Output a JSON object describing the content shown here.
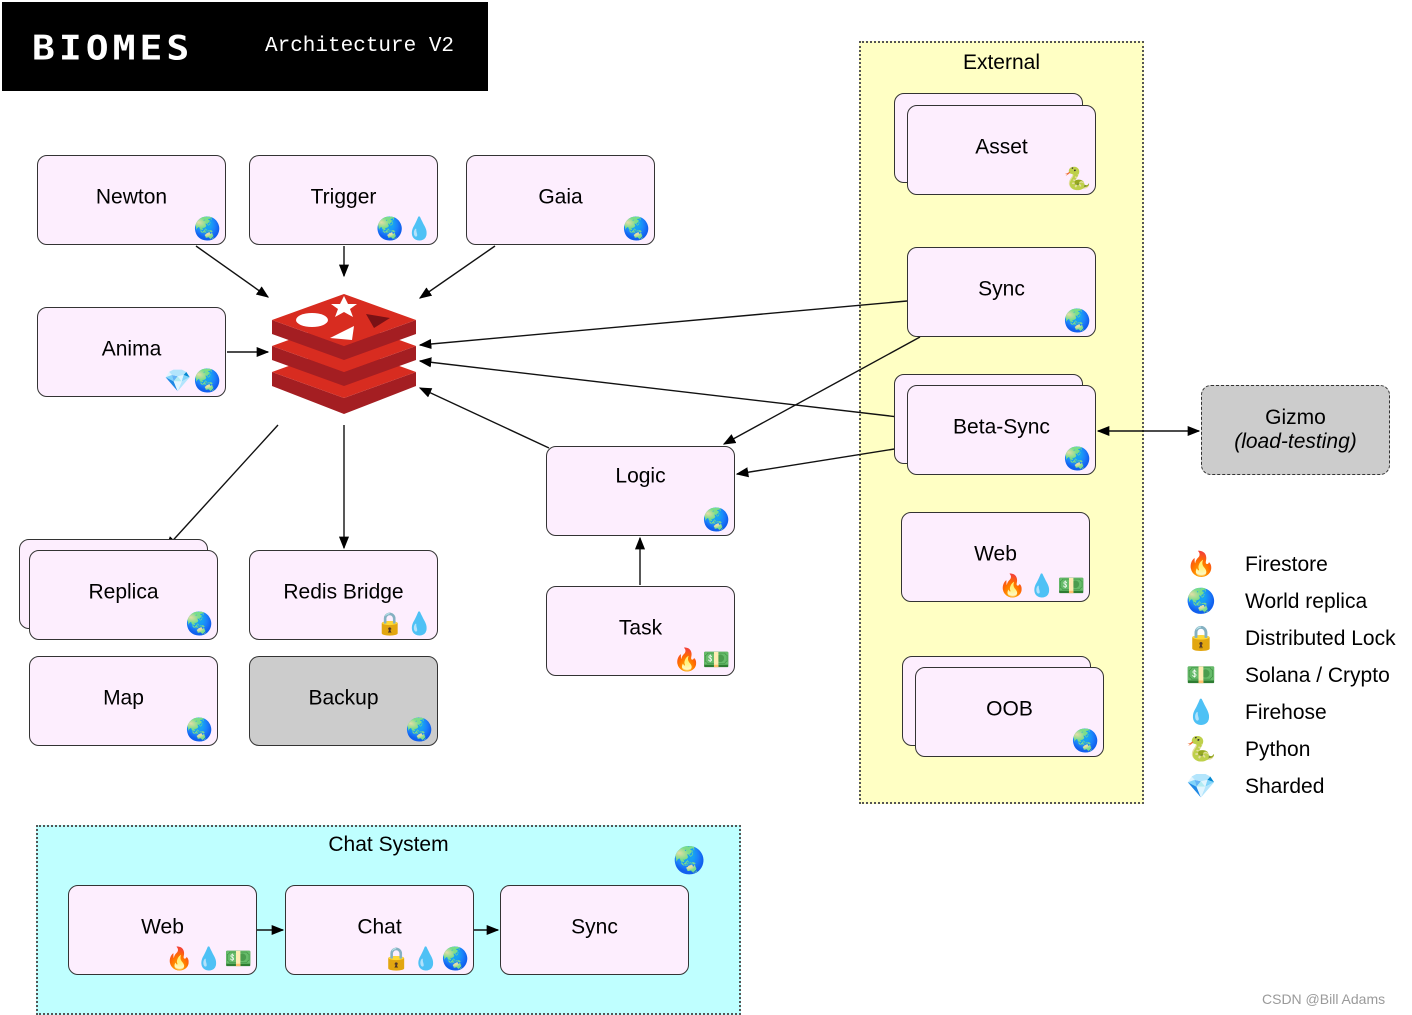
{
  "header": {
    "logo": "BIOMES",
    "subtitle": "Architecture V2"
  },
  "icons": {
    "firestore": "🔥",
    "world_replica": "🌏",
    "distributed_lock": "🔒",
    "solana": "💵",
    "firehose": "💧",
    "python": "🐍",
    "sharded": "💎"
  },
  "hub": {
    "name": "Redis",
    "icon": "redis-logo-icon"
  },
  "nodes": {
    "newton": {
      "label": "Newton",
      "badges": [
        "🌏"
      ]
    },
    "trigger": {
      "label": "Trigger",
      "badges": [
        "🌏",
        "💧"
      ]
    },
    "gaia": {
      "label": "Gaia",
      "badges": [
        "🌏"
      ]
    },
    "anima": {
      "label": "Anima",
      "badges": [
        "💎",
        "🌏"
      ]
    },
    "replica": {
      "label": "Replica",
      "badges": [
        "🌏"
      ]
    },
    "redis_bridge": {
      "label": "Redis Bridge",
      "badges": [
        "🔒",
        "💧"
      ]
    },
    "map": {
      "label": "Map",
      "badges": [
        "🌏"
      ]
    },
    "backup": {
      "label": "Backup",
      "badges": [
        "🌏"
      ]
    },
    "logic": {
      "label": "Logic",
      "badges": [
        "🌏"
      ]
    },
    "task": {
      "label": "Task",
      "badges": [
        "🔥",
        "💵"
      ]
    },
    "gizmo": {
      "label": "Gizmo",
      "sublabel": "(load-testing)"
    }
  },
  "external": {
    "title": "External",
    "nodes": {
      "asset": {
        "label": "Asset",
        "badges": [
          "🐍"
        ]
      },
      "sync": {
        "label": "Sync",
        "badges": [
          "🌏"
        ]
      },
      "beta_sync": {
        "label": "Beta-Sync",
        "badges": [
          "🌏"
        ]
      },
      "web": {
        "label": "Web",
        "badges": [
          "🔥",
          "💧",
          "💵"
        ]
      },
      "oob": {
        "label": "OOB",
        "badges": [
          "🌏"
        ]
      }
    }
  },
  "chat_system": {
    "title": "Chat System",
    "badge": "🌏",
    "nodes": {
      "web": {
        "label": "Web",
        "badges": [
          "🔥",
          "💧",
          "💵"
        ]
      },
      "chat": {
        "label": "Chat",
        "badges": [
          "🔒",
          "💧",
          "🌏"
        ]
      },
      "sync": {
        "label": "Sync",
        "badges": []
      }
    }
  },
  "legend": [
    {
      "icon": "🔥",
      "name": "fire-icon",
      "label": "Firestore"
    },
    {
      "icon": "🌏",
      "name": "globe-icon",
      "label": "World replica"
    },
    {
      "icon": "🔒",
      "name": "lock-icon",
      "label": "Distributed Lock"
    },
    {
      "icon": "💵",
      "name": "money-icon",
      "label": "Solana / Crypto"
    },
    {
      "icon": "💧",
      "name": "droplet-icon",
      "label": "Firehose"
    },
    {
      "icon": "🐍",
      "name": "snake-icon",
      "label": "Python"
    },
    {
      "icon": "💎",
      "name": "gem-icon",
      "label": "Sharded"
    }
  ],
  "edges": [
    {
      "from": "Newton",
      "to": "Redis"
    },
    {
      "from": "Trigger",
      "to": "Redis"
    },
    {
      "from": "Gaia",
      "to": "Redis"
    },
    {
      "from": "Anima",
      "to": "Redis"
    },
    {
      "from": "Sync",
      "to": "Redis"
    },
    {
      "from": "Beta-Sync",
      "to": "Redis"
    },
    {
      "from": "Logic",
      "to": "Redis"
    },
    {
      "from": "Redis",
      "to": "Replica"
    },
    {
      "from": "Redis",
      "to": "Redis Bridge"
    },
    {
      "from": "Sync",
      "to": "Logic"
    },
    {
      "from": "Beta-Sync",
      "to": "Logic"
    },
    {
      "from": "Task",
      "to": "Logic"
    },
    {
      "from": "Beta-Sync",
      "to": "Gizmo",
      "bidirectional": true
    },
    {
      "from": "Chat Web",
      "to": "Chat"
    },
    {
      "from": "Chat",
      "to": "Chat Sync"
    }
  ],
  "watermark": "CSDN @Bill Adams"
}
